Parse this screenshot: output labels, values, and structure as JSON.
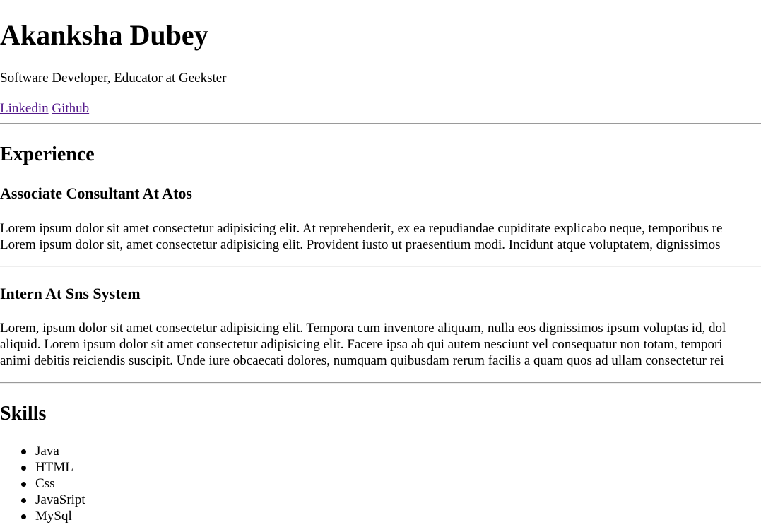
{
  "header": {
    "name": "Akanksha Dubey",
    "subtitle": "Software Developer, Educator at Geekster",
    "links": [
      {
        "label": "Linkedin"
      },
      {
        "label": "Github"
      }
    ]
  },
  "experience": {
    "heading": "Experience",
    "roles": [
      {
        "title": "Associate Consultant At Atos",
        "lines": [
          "Lorem ipsum dolor sit amet consectetur adipisicing elit. At reprehenderit, ex ea repudiandae cupiditate explicabo neque, temporibus re",
          "Lorem ipsum dolor sit, amet consectetur adipisicing elit. Provident iusto ut praesentium modi. Incidunt atque voluptatem, dignissimos"
        ]
      },
      {
        "title": "Intern At Sns System",
        "lines": [
          "Lorem, ipsum dolor sit amet consectetur adipisicing elit. Tempora cum inventore aliquam, nulla eos dignissimos ipsum voluptas id, dol",
          "aliquid. Lorem ipsum dolor sit amet consectetur adipisicing elit. Facere ipsa ab qui autem nesciunt vel consequatur non totam, tempori",
          "animi debitis reiciendis suscipit. Unde iure obcaecati dolores, numquam quibusdam rerum facilis a quam quos ad ullam consectetur rei"
        ]
      }
    ]
  },
  "skills": {
    "heading": "Skills",
    "items": [
      "Java",
      "HTML",
      "Css",
      "JavaSript",
      "MySql"
    ]
  }
}
